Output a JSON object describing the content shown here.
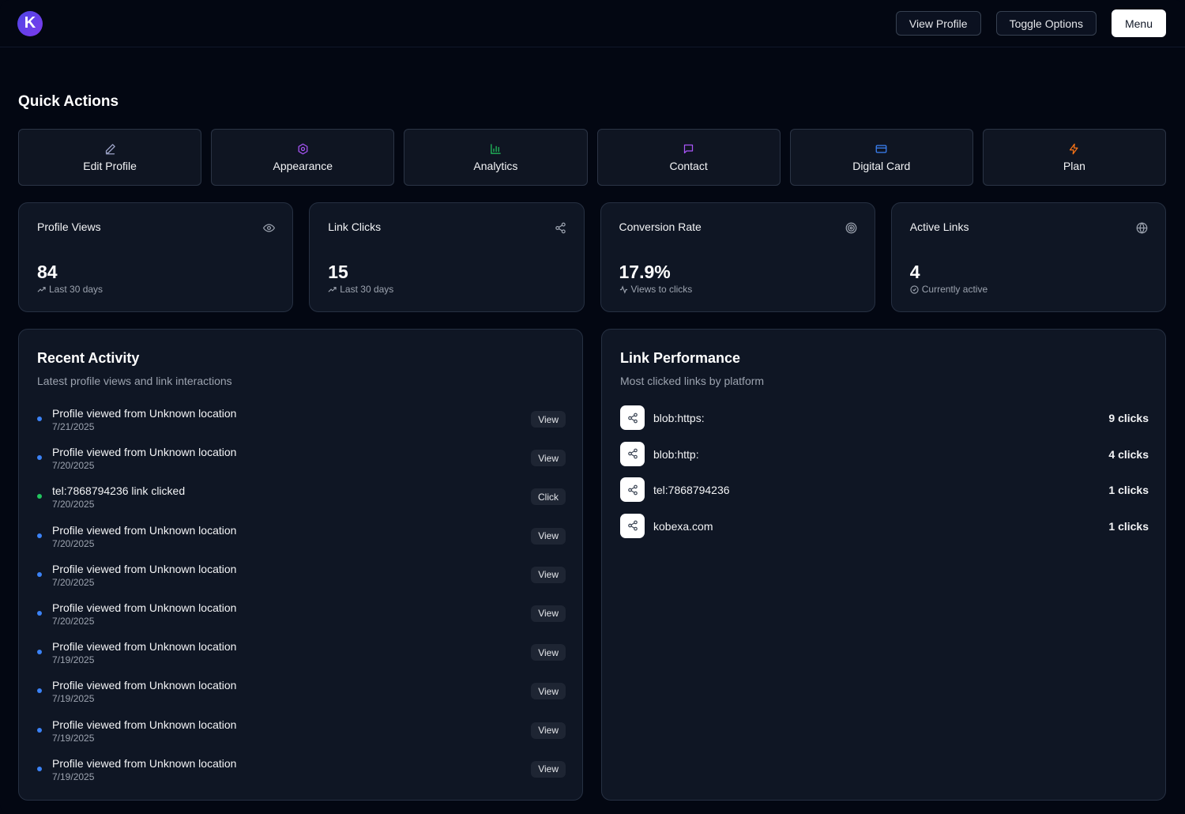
{
  "header": {
    "logo_letter": "K",
    "view_profile": "View Profile",
    "toggle_options": "Toggle Options",
    "menu": "Menu"
  },
  "quick_actions": {
    "title": "Quick Actions",
    "items": [
      {
        "label": "Edit Profile",
        "icon": "pencil-icon",
        "color": "#9ca3c7"
      },
      {
        "label": "Appearance",
        "icon": "gear-icon",
        "color": "#a855f7"
      },
      {
        "label": "Analytics",
        "icon": "bar-chart-icon",
        "color": "#22c55e"
      },
      {
        "label": "Contact",
        "icon": "message-icon",
        "color": "#a855f7"
      },
      {
        "label": "Digital Card",
        "icon": "card-icon",
        "color": "#3b82f6"
      },
      {
        "label": "Plan",
        "icon": "zap-icon",
        "color": "#f97316"
      }
    ]
  },
  "stats": [
    {
      "title": "Profile Views",
      "value": "84",
      "sub": "Last 30 days",
      "icon": "eye-icon"
    },
    {
      "title": "Link Clicks",
      "value": "15",
      "sub": "Last 30 days",
      "icon": "share-icon"
    },
    {
      "title": "Conversion Rate",
      "value": "17.9%",
      "sub": "Views to clicks",
      "icon": "target-icon"
    },
    {
      "title": "Active Links",
      "value": "4",
      "sub": "Currently active",
      "icon": "globe-icon"
    }
  ],
  "recent_activity": {
    "title": "Recent Activity",
    "subtitle": "Latest profile views and link interactions",
    "items": [
      {
        "text": "Profile viewed from Unknown location",
        "date": "7/21/2025",
        "badge": "View",
        "type": "view"
      },
      {
        "text": "Profile viewed from Unknown location",
        "date": "7/20/2025",
        "badge": "View",
        "type": "view"
      },
      {
        "text": "tel:7868794236 link clicked",
        "date": "7/20/2025",
        "badge": "Click",
        "type": "click"
      },
      {
        "text": "Profile viewed from Unknown location",
        "date": "7/20/2025",
        "badge": "View",
        "type": "view"
      },
      {
        "text": "Profile viewed from Unknown location",
        "date": "7/20/2025",
        "badge": "View",
        "type": "view"
      },
      {
        "text": "Profile viewed from Unknown location",
        "date": "7/20/2025",
        "badge": "View",
        "type": "view"
      },
      {
        "text": "Profile viewed from Unknown location",
        "date": "7/19/2025",
        "badge": "View",
        "type": "view"
      },
      {
        "text": "Profile viewed from Unknown location",
        "date": "7/19/2025",
        "badge": "View",
        "type": "view"
      },
      {
        "text": "Profile viewed from Unknown location",
        "date": "7/19/2025",
        "badge": "View",
        "type": "view"
      },
      {
        "text": "Profile viewed from Unknown location",
        "date": "7/19/2025",
        "badge": "View",
        "type": "view"
      }
    ]
  },
  "link_performance": {
    "title": "Link Performance",
    "subtitle": "Most clicked links by platform",
    "items": [
      {
        "name": "blob:https:",
        "clicks": "9 clicks"
      },
      {
        "name": "blob:http:",
        "clicks": "4 clicks"
      },
      {
        "name": "tel:7868794236",
        "clicks": "1 clicks"
      },
      {
        "name": "kobexa.com",
        "clicks": "1 clicks"
      }
    ]
  }
}
